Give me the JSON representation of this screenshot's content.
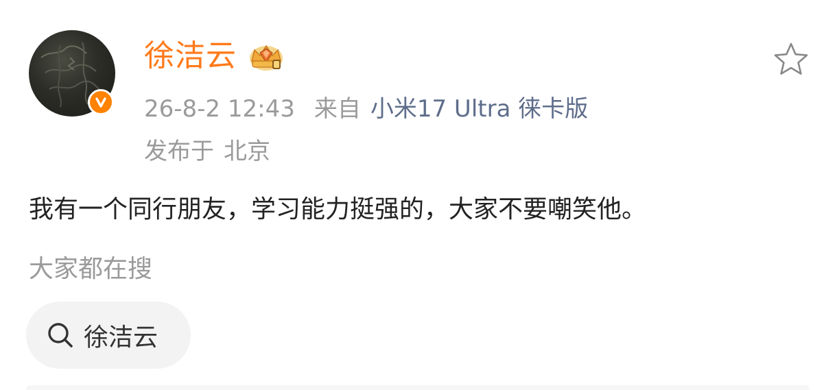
{
  "post": {
    "author": {
      "name": "徐洁云",
      "avatar_icon": "avatar-dark-texture",
      "verified_badge_icon": "orange-v-verified-icon",
      "rank_icon": "gold-crown-icon",
      "name_color": "#ff7a1a"
    },
    "meta": {
      "time": "26-8-2 12:43",
      "from_label": "来自",
      "device": "小米17 Ultra 徕卡版"
    },
    "location": {
      "label": "发布于",
      "value": "北京"
    },
    "text": "我有一个同行朋友，学习能力挺强的，大家不要嘲笑他。",
    "favorite_icon": "star-outline-icon"
  },
  "trending": {
    "title": "大家都在搜",
    "chips": [
      {
        "icon": "search-icon",
        "label": "徐洁云"
      }
    ]
  },
  "colors": {
    "accent_orange": "#ff8200",
    "secondary_text": "#9a9a9a",
    "device_link": "#5e6d8a",
    "body_text": "#222222",
    "chip_background": "#f3f3f3"
  }
}
